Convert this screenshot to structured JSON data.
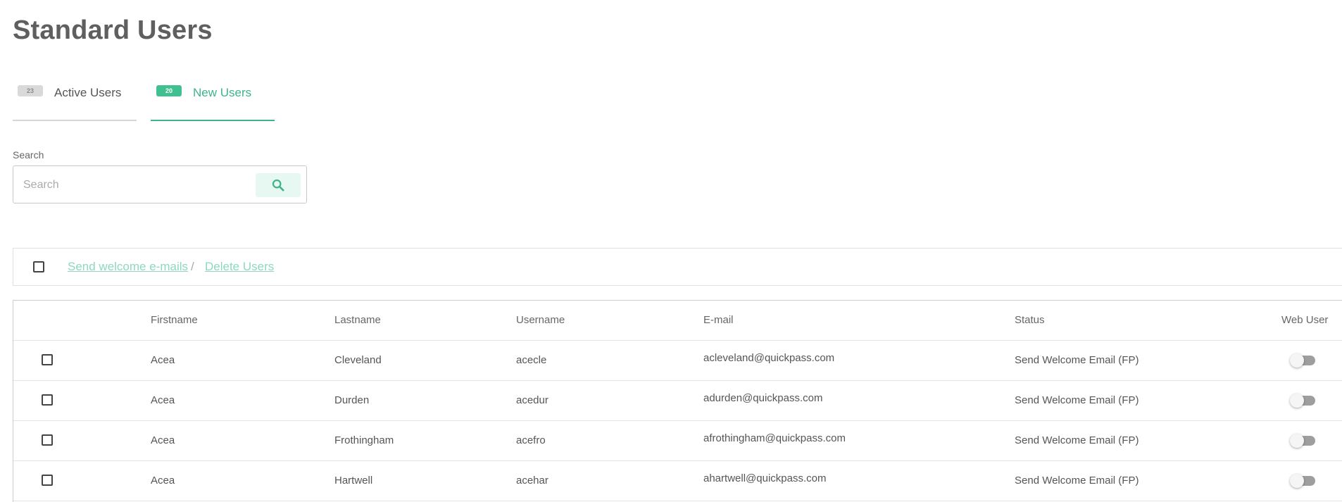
{
  "page": {
    "title": "Standard Users"
  },
  "tabs": [
    {
      "badge": "23",
      "label": "Active Users",
      "active": false
    },
    {
      "badge": "20",
      "label": "New Users",
      "active": true
    }
  ],
  "search": {
    "label": "Search",
    "placeholder": "Search",
    "value": ""
  },
  "actions": {
    "send_welcome": "Send welcome e-mails",
    "separator": "/",
    "delete_users": "Delete Users"
  },
  "table": {
    "columns": {
      "firstname": "Firstname",
      "lastname": "Lastname",
      "username": "Username",
      "email": "E-mail",
      "status": "Status",
      "web_user": "Web User"
    },
    "rows": [
      {
        "firstname": "Acea",
        "lastname": "Cleveland",
        "username": "acecle",
        "email": "acleveland@quickpass.com",
        "status": "Send Welcome Email (FP)",
        "web_user": false
      },
      {
        "firstname": "Acea",
        "lastname": "Durden",
        "username": "acedur",
        "email": "adurden@quickpass.com",
        "status": "Send Welcome Email (FP)",
        "web_user": false
      },
      {
        "firstname": "Acea",
        "lastname": "Frothingham",
        "username": "acefro",
        "email": "afrothingham@quickpass.com",
        "status": "Send Welcome Email (FP)",
        "web_user": false
      },
      {
        "firstname": "Acea",
        "lastname": "Hartwell",
        "username": "acehar",
        "email": "ahartwell@quickpass.com",
        "status": "Send Welcome Email (FP)",
        "web_user": false
      }
    ]
  },
  "colors": {
    "accent": "#3db489",
    "accent_light": "#8ed8bd",
    "search_button_bg": "#e7f7f1"
  },
  "icons": {
    "search_button": "search-icon"
  }
}
